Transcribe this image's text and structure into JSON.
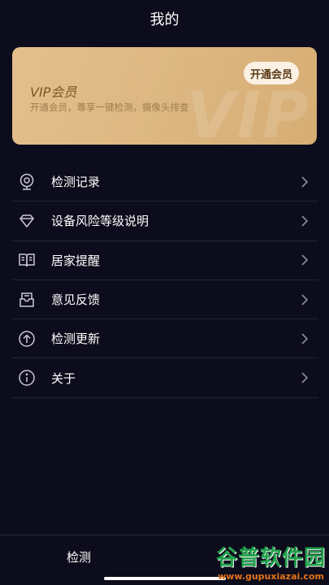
{
  "header": {
    "title": "我的"
  },
  "vip_card": {
    "title": "VIP会员",
    "subtitle": "开通会员，尊享一键检测，摄像头排查",
    "button_label": "开通会员",
    "watermark": "VIP"
  },
  "menu": {
    "items": [
      {
        "label": "检测记录",
        "icon": "webcam-icon"
      },
      {
        "label": "设备风险等级说明",
        "icon": "diamond-icon"
      },
      {
        "label": "居家提醒",
        "icon": "book-icon"
      },
      {
        "label": "意见反馈",
        "icon": "mailbox-icon"
      },
      {
        "label": "检测更新",
        "icon": "arrow-up-circle-icon"
      },
      {
        "label": "关于",
        "icon": "info-circle-icon"
      }
    ]
  },
  "tabbar": {
    "detect_label": "检测"
  },
  "watermark": {
    "cn": "谷普软件园",
    "url": "www.gupuxiazai.com"
  },
  "colors": {
    "background": "#0d0c1c",
    "vip_gold": "#ddb883",
    "vip_text": "#7c5526",
    "divider": "#25243a"
  }
}
